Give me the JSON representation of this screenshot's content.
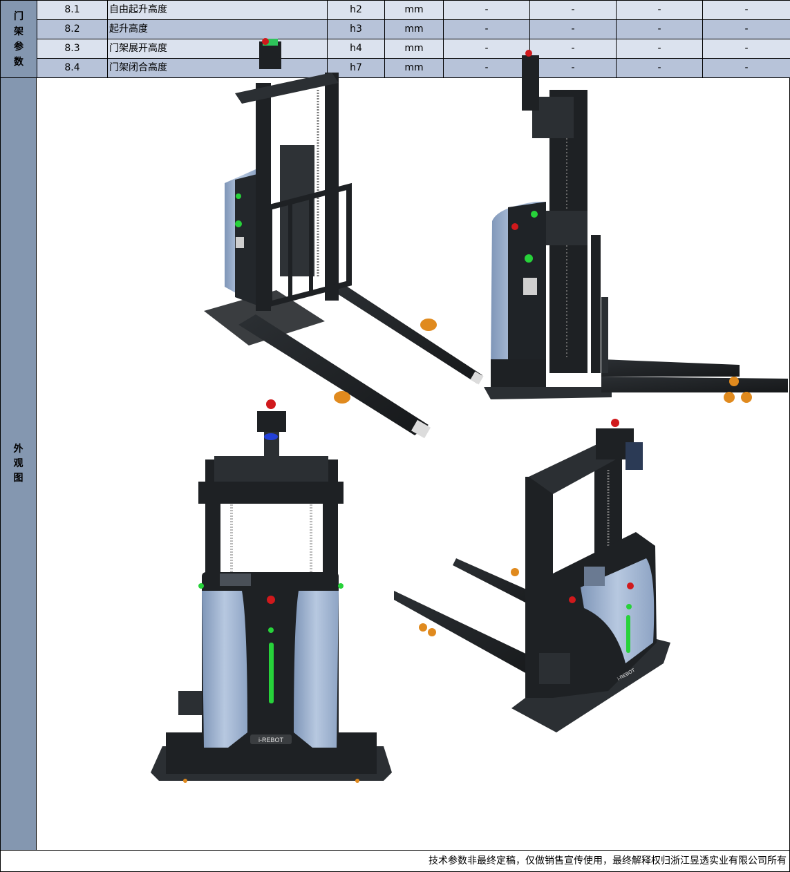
{
  "mast_section": {
    "group_label": "门架参数",
    "rows": [
      {
        "num": "8.1",
        "name": "自由起升高度",
        "symbol": "h2",
        "unit": "mm",
        "v1": "-",
        "v2": "-",
        "v3": "-",
        "v4": "-"
      },
      {
        "num": "8.2",
        "name": "起升高度",
        "symbol": "h3",
        "unit": "mm",
        "v1": "-",
        "v2": "-",
        "v3": "-",
        "v4": "-"
      },
      {
        "num": "8.3",
        "name": "门架展开高度",
        "symbol": "h4",
        "unit": "mm",
        "v1": "-",
        "v2": "-",
        "v3": "-",
        "v4": "-"
      },
      {
        "num": "8.4",
        "name": "门架闭合高度",
        "symbol": "h7",
        "unit": "mm",
        "v1": "-",
        "v2": "-",
        "v3": "-",
        "v4": "-"
      }
    ]
  },
  "appearance": {
    "label": "外观图",
    "brand_logo": "i-REBOT",
    "product_views": [
      "rear-left-isometric",
      "side",
      "rear",
      "front-right-isometric"
    ],
    "colors": {
      "body_blue": "#9fb3cf",
      "frame_black": "#1e2124",
      "led_green": "#27d23a",
      "estop_red": "#d0191c",
      "wheel_orange": "#e08a1e"
    }
  },
  "footer": {
    "disclaimer": "技术参数非最终定稿，仅做销售宣传使用，最终解释权归浙江昱透实业有限公司所有"
  }
}
